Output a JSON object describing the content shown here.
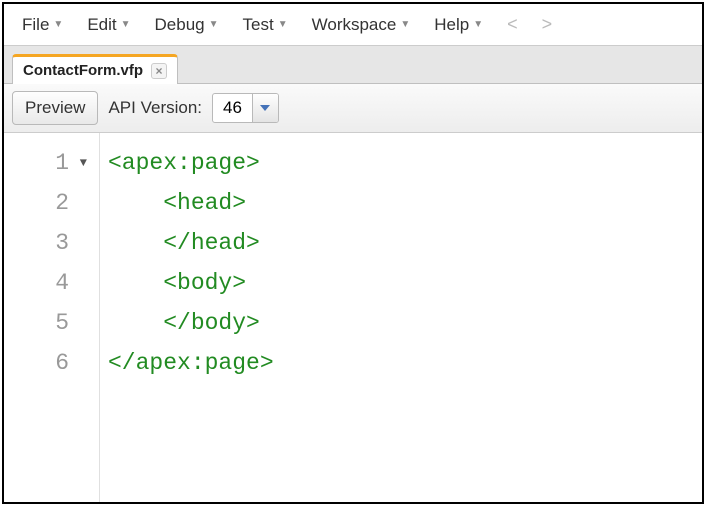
{
  "menu": {
    "items": [
      "File",
      "Edit",
      "Debug",
      "Test",
      "Workspace",
      "Help"
    ],
    "prev": "<",
    "next": ">"
  },
  "tab": {
    "label": "ContactForm.vfp",
    "close": "×"
  },
  "toolbar": {
    "preview_label": "Preview",
    "api_version_label": "API Version:",
    "api_version_value": "46"
  },
  "editor": {
    "lines": [
      {
        "num": "1",
        "foldable": true,
        "text": "<apex:page>"
      },
      {
        "num": "2",
        "foldable": false,
        "text": "    <head>"
      },
      {
        "num": "3",
        "foldable": false,
        "text": "    </head>"
      },
      {
        "num": "4",
        "foldable": false,
        "text": "    <body>"
      },
      {
        "num": "5",
        "foldable": false,
        "text": "    </body>"
      },
      {
        "num": "6",
        "foldable": false,
        "text": "</apex:page>"
      }
    ]
  }
}
